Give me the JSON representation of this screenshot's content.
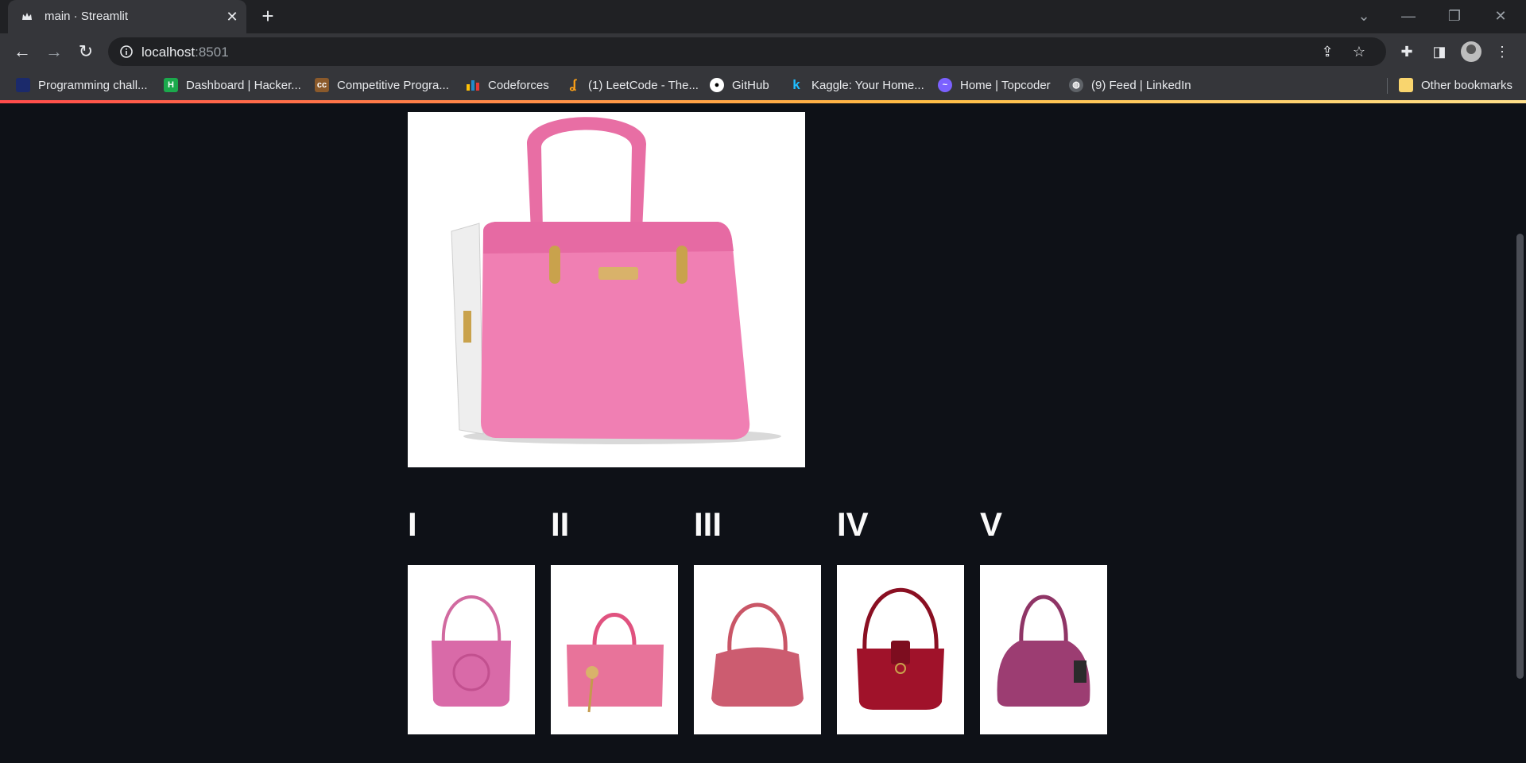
{
  "browser": {
    "tab_title": "main · Streamlit",
    "new_tab_icon": "plus-icon",
    "url_host": "localhost",
    "url_port": ":8501",
    "bookmarks": [
      {
        "label": "Programming chall...",
        "icon": "square-icon",
        "color": "#1b2a6b"
      },
      {
        "label": "Dashboard | Hacker...",
        "icon": "hackerrank-icon",
        "color": "#1ba94c"
      },
      {
        "label": "Competitive Progra...",
        "icon": "codechef-icon",
        "color": "#8b5a2b"
      },
      {
        "label": "Codeforces",
        "icon": "codeforces-icon",
        "color": "#1f8acb"
      },
      {
        "label": "(1) LeetCode - The...",
        "icon": "leetcode-icon",
        "color": "#ffa116"
      },
      {
        "label": "GitHub",
        "icon": "github-icon",
        "color": "#ffffff"
      },
      {
        "label": "Kaggle: Your Home...",
        "icon": "kaggle-icon",
        "color": "#20beff"
      },
      {
        "label": "Home | Topcoder",
        "icon": "topcoder-icon",
        "color": "#7b61ff"
      },
      {
        "label": "(9) Feed | LinkedIn",
        "icon": "globe-icon",
        "color": "#9aa0a6"
      }
    ],
    "other_bookmarks": "Other bookmarks"
  },
  "app": {
    "main_image": {
      "subject": "pink-handbag",
      "color": "#ee7fb0"
    },
    "recommendations": [
      {
        "label": "I",
        "color": "#d96aa8"
      },
      {
        "label": "II",
        "color": "#e8739a"
      },
      {
        "label": "III",
        "color": "#cc5c70"
      },
      {
        "label": "IV",
        "color": "#a0122a"
      },
      {
        "label": "V",
        "color": "#9c3d72"
      }
    ]
  }
}
